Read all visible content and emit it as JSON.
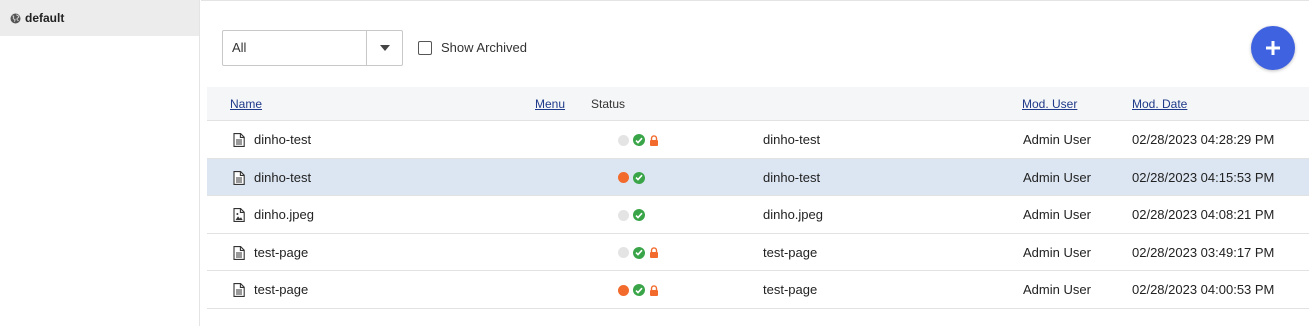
{
  "sidebar": {
    "site": {
      "icon": "globe-icon",
      "label": "default"
    }
  },
  "toolbar": {
    "filter": {
      "value": "All",
      "icon": "caret-down-icon"
    },
    "show_archived": {
      "label": "Show Archived",
      "checked": false
    },
    "add_button": {
      "icon": "plus-icon"
    }
  },
  "table": {
    "headers": {
      "name": "Name",
      "menu": "Menu",
      "status": "Status",
      "mod_user": "Mod. User",
      "mod_date": "Mod. Date"
    },
    "rows": [
      {
        "icon": "document-icon",
        "name": "dinho-test",
        "state": "grey",
        "published": true,
        "locked": true,
        "path": "dinho-test",
        "mod_user": "Admin User",
        "mod_date": "02/28/2023 04:28:29 PM",
        "selected": false
      },
      {
        "icon": "document-icon",
        "name": "dinho-test",
        "state": "orange",
        "published": true,
        "locked": false,
        "path": "dinho-test",
        "mod_user": "Admin User",
        "mod_date": "02/28/2023 04:15:53 PM",
        "selected": true
      },
      {
        "icon": "image-file-icon",
        "name": "dinho.jpeg",
        "state": "grey",
        "published": true,
        "locked": false,
        "path": "dinho.jpeg",
        "mod_user": "Admin User",
        "mod_date": "02/28/2023 04:08:21 PM",
        "selected": false
      },
      {
        "icon": "document-icon",
        "name": "test-page",
        "state": "grey",
        "published": true,
        "locked": true,
        "path": "test-page",
        "mod_user": "Admin User",
        "mod_date": "02/28/2023 03:49:17 PM",
        "selected": false
      },
      {
        "icon": "document-icon",
        "name": "test-page",
        "state": "orange",
        "published": true,
        "locked": true,
        "path": "test-page",
        "mod_user": "Admin User",
        "mod_date": "02/28/2023 04:00:53 PM",
        "selected": false
      }
    ]
  },
  "colors": {
    "accent": "#3f62e0",
    "selected_row": "#dce6f2",
    "status_orange": "#f26b2d",
    "status_green": "#3aa548",
    "lock": "#f26b2d"
  }
}
